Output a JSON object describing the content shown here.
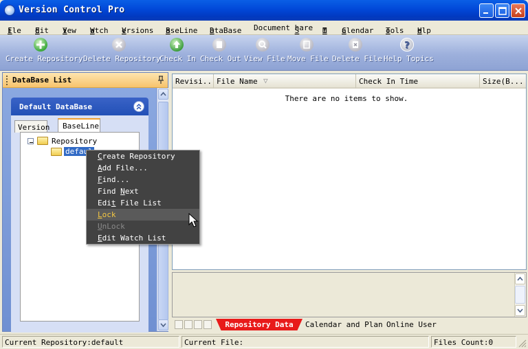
{
  "window": {
    "title": "Version Control Pro"
  },
  "menu": [
    "File",
    "Edit",
    "View",
    "Watch",
    "Versions",
    "BaseLine",
    "DataBase",
    "Document Share",
    "IM",
    "Calendar",
    "Tools",
    "Help"
  ],
  "menu_ul": [
    "F",
    "E",
    "V",
    "W",
    "V",
    "B",
    "D",
    "S",
    "I",
    "C",
    "T",
    "H"
  ],
  "toolbar": [
    {
      "label": "Create Repository",
      "icon": "add-icon"
    },
    {
      "label": "Delete Repository",
      "icon": "delete-icon"
    },
    {
      "label": "Check In",
      "icon": "check-in-icon"
    },
    {
      "label": "Check Out",
      "icon": "check-out-icon"
    },
    {
      "label": "View File",
      "icon": "view-file-icon"
    },
    {
      "label": "Move File",
      "icon": "move-file-icon"
    },
    {
      "label": "Delete File",
      "icon": "delete-file-icon"
    },
    {
      "label": "Help Topics",
      "icon": "help-icon"
    }
  ],
  "left_pane": {
    "header": "DataBase List",
    "group_title": "Default DataBase",
    "tabs": [
      "Version",
      "BaseLine"
    ],
    "tree": {
      "root": "Repository",
      "child": "defaul"
    }
  },
  "list": {
    "columns": [
      "Revisi...",
      "File Name",
      "Check In Time",
      "Size(B..."
    ],
    "empty": "There are no items to show."
  },
  "bottom_tabs": [
    "Repository Data",
    "Calendar and Plan",
    "Online User"
  ],
  "context_menu": [
    {
      "label": "Create Repository",
      "state": "normal"
    },
    {
      "label": "Add File...",
      "state": "normal"
    },
    {
      "label": "Find...",
      "state": "normal"
    },
    {
      "label": "Find Next",
      "state": "normal"
    },
    {
      "label": "Edit File List",
      "state": "normal"
    },
    {
      "label": "Lock",
      "state": "hover"
    },
    {
      "label": "UnLock",
      "state": "disabled"
    },
    {
      "label": "Edit Watch List",
      "state": "normal"
    }
  ],
  "status": {
    "repository": "Current Repository:default",
    "file": "Current File:",
    "count": "Files Count:0"
  },
  "colors": {
    "title_blue": "#0148d8",
    "active_tab": "#e81a1a",
    "menu_dark": "#424242",
    "hover_text": "#f5c842"
  }
}
